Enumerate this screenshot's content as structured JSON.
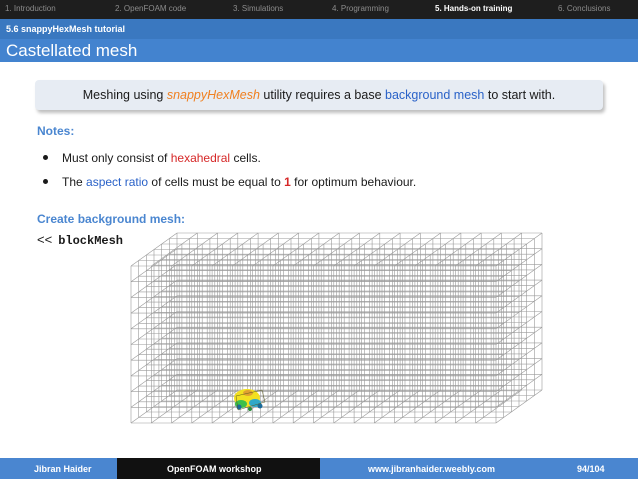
{
  "nav": {
    "items": [
      {
        "label": "1. Introduction",
        "active": false
      },
      {
        "label": "2. OpenFOAM code",
        "active": false
      },
      {
        "label": "3. Simulations",
        "active": false
      },
      {
        "label": "4. Programming",
        "active": false
      },
      {
        "label": "5. Hands-on training",
        "active": true
      },
      {
        "label": "6. Conclusions",
        "active": false
      }
    ]
  },
  "subsection": "5.6 snappyHexMesh tutorial",
  "title": "Castellated mesh",
  "callout": {
    "pre": "Meshing using ",
    "utility": "snappyHexMesh",
    "mid": " utility requires a base ",
    "highlight": "background mesh",
    "post": " to start with."
  },
  "notes": {
    "heading": "Notes:",
    "bullet1": {
      "pre": "Must only consist of ",
      "red": "hexahedral",
      "post": " cells."
    },
    "bullet2": {
      "pre": "The ",
      "blue": "aspect ratio",
      "mid": " of cells must be equal to ",
      "red": "1",
      "post": " for optimum behaviour."
    }
  },
  "create": {
    "heading": "Create background mesh:",
    "prompt": "<<",
    "command": "blockMesh"
  },
  "footer": {
    "author": "Jibran Haider",
    "workshop": "OpenFOAM workshop",
    "website": "www.jibranhaider.weebly.com",
    "page": "94/104"
  },
  "colors": {
    "nav_bg": "#1e1e1e",
    "subsection_bg": "#3a78c0",
    "title_bg": "#4383cf",
    "accent_blue": "#2a62c8",
    "accent_red": "#d62828",
    "accent_orange": "#f08020",
    "mesh_line": "#9a9a9a"
  }
}
